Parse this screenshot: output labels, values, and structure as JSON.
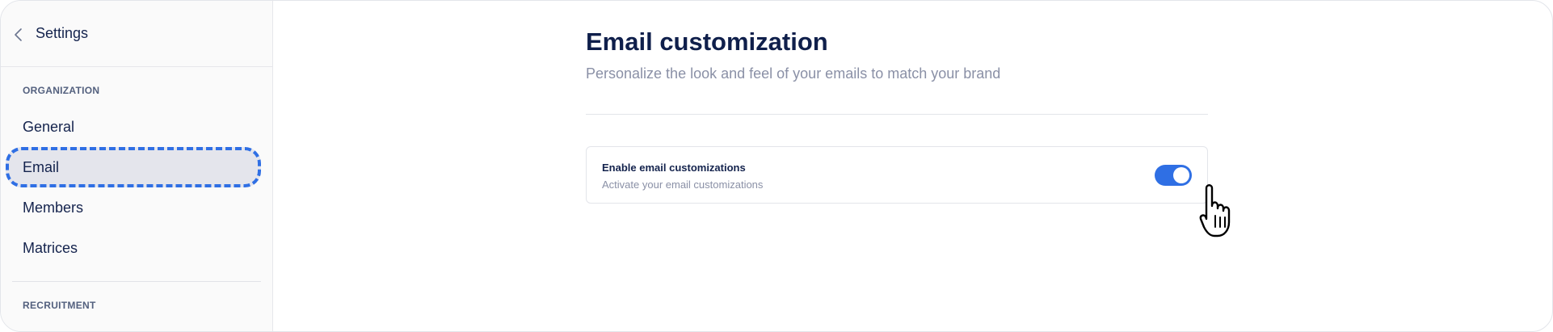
{
  "sidebar": {
    "header_title": "Settings",
    "sections": [
      {
        "label": "ORGANIZATION"
      },
      {
        "label": "RECRUITMENT"
      }
    ],
    "items": [
      {
        "label": "General"
      },
      {
        "label": "Email",
        "active": true
      },
      {
        "label": "Members"
      },
      {
        "label": "Matrices"
      }
    ]
  },
  "main": {
    "title": "Email customization",
    "subtitle": "Personalize the look and feel of your emails to match your brand",
    "setting": {
      "title": "Enable email customizations",
      "description": "Activate your email customizations",
      "enabled": true
    }
  },
  "colors": {
    "accent": "#2f6fe4",
    "text_primary": "#0f1f4b",
    "text_muted": "#8a90a6",
    "active_bg": "#e4e5ec"
  },
  "icons": {
    "back": "chevron-left-icon",
    "cursor": "hand-pointer-cursor-icon"
  }
}
